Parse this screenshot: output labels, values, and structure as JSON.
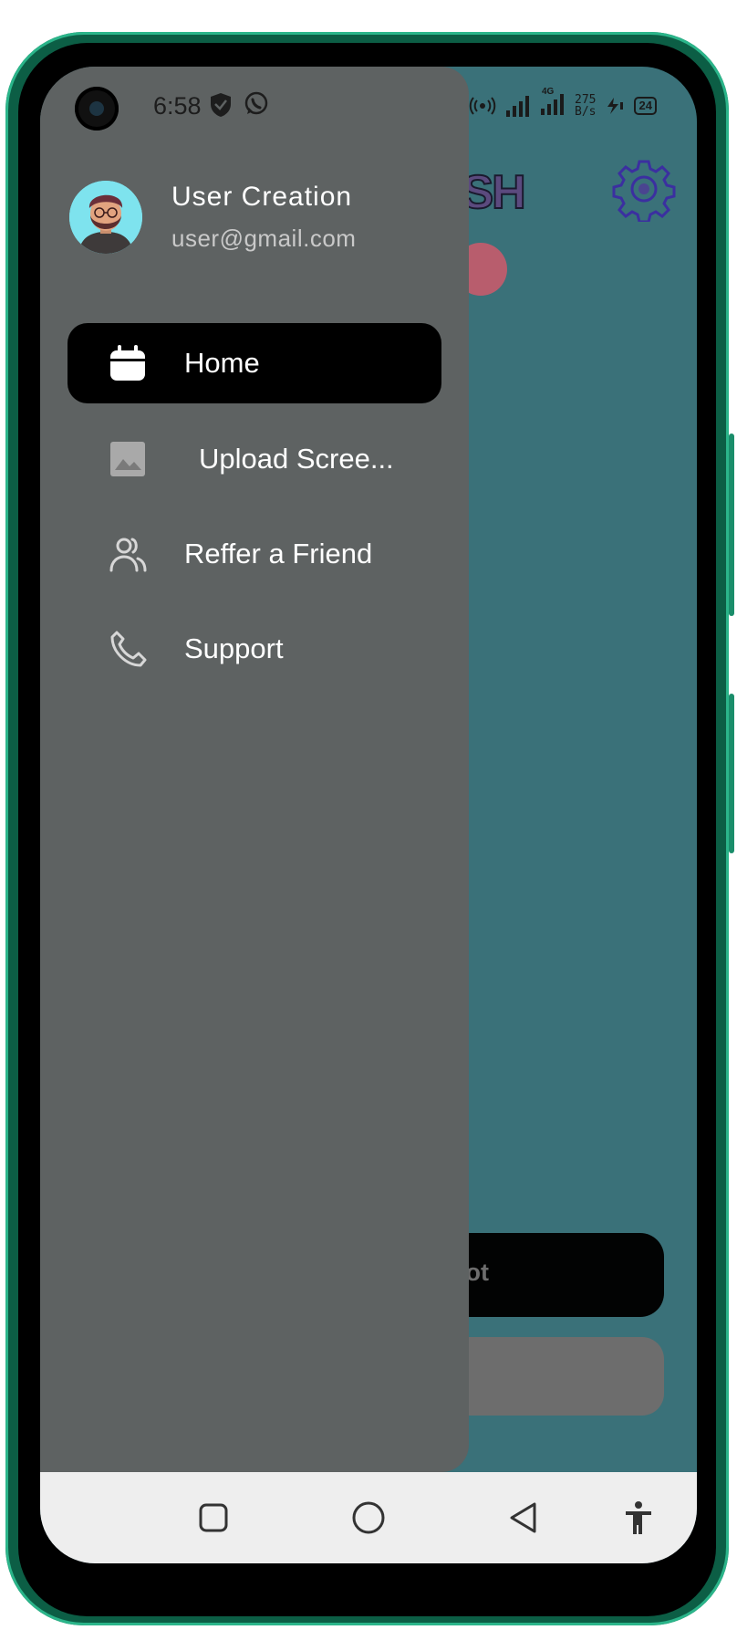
{
  "status_bar": {
    "time": "6:58",
    "net_speed_value": "275",
    "net_speed_unit": "B/s",
    "network_type": "4G",
    "battery": "24"
  },
  "background_app": {
    "title_fragment": "ISH",
    "button_primary_fragment": "ot"
  },
  "drawer": {
    "user": {
      "name": "User Creation",
      "email": "user@gmail.com"
    },
    "items": [
      {
        "label": "Home",
        "icon": "calendar-icon",
        "active": true
      },
      {
        "label": "Upload Scree...",
        "icon": "image-icon",
        "active": false
      },
      {
        "label": "Reffer a Friend",
        "icon": "people-icon",
        "active": false
      },
      {
        "label": "Support",
        "icon": "phone-icon",
        "active": false
      }
    ]
  },
  "colors": {
    "drawer_bg": "#5e6262",
    "active_item_bg": "#000000",
    "app_bg": "#3a7179",
    "phone_frame": "#0c5e45"
  }
}
